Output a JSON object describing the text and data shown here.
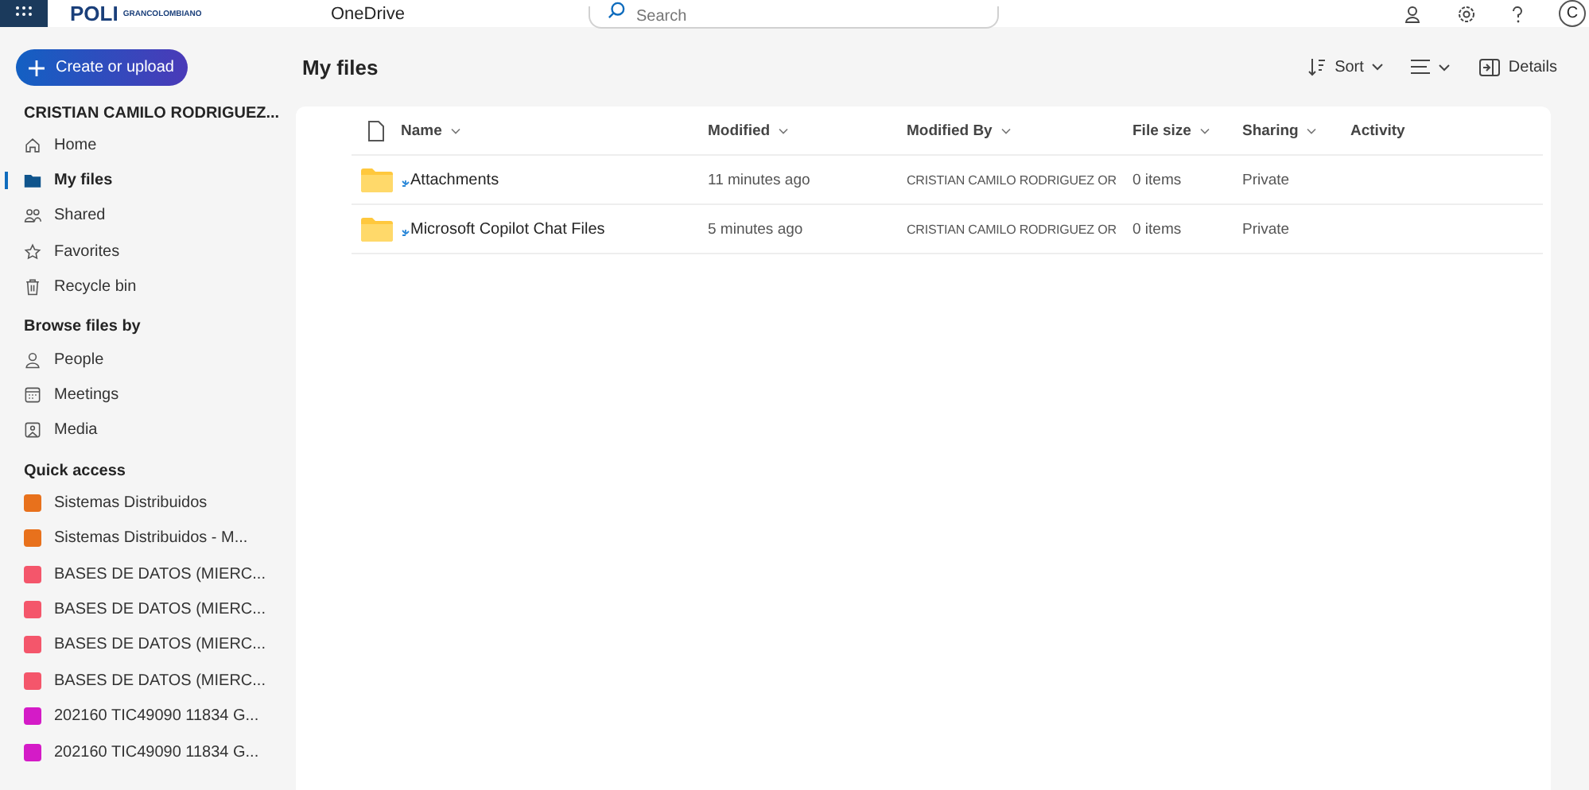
{
  "top_bar": {
    "logo_text": "POLI",
    "logo_subtext": "GRANCOLOMBIANO",
    "app_name": "OneDrive",
    "search": {
      "placeholder": "Search"
    },
    "avatar": "C"
  },
  "create_button": "Create or upload",
  "page_title": "My files",
  "toolbar": {
    "sort": "Sort",
    "details": "Details"
  },
  "sidebar": {
    "account": "CRISTIAN CAMILO RODRIGUEZ...",
    "nav": [
      {
        "label": "Home",
        "selected": false
      },
      {
        "label": "My files",
        "selected": true
      },
      {
        "label": "Shared",
        "selected": false
      },
      {
        "label": "Favorites",
        "selected": false
      },
      {
        "label": "Recycle bin",
        "selected": false
      }
    ],
    "browse_heading": "Browse files by",
    "browse": [
      {
        "label": "People"
      },
      {
        "label": "Meetings"
      },
      {
        "label": "Media"
      }
    ],
    "quick_heading": "Quick access",
    "quick": [
      {
        "label": "Sistemas Distribuidos",
        "color": "#e8711c"
      },
      {
        "label": "Sistemas Distribuidos - M...",
        "color": "#e8711c"
      },
      {
        "label": "BASES DE DATOS (MIERC...",
        "color": "#f4566b"
      },
      {
        "label": "BASES DE DATOS (MIERC...",
        "color": "#f4566b"
      },
      {
        "label": "BASES DE DATOS (MIERC...",
        "color": "#f4566b"
      },
      {
        "label": "BASES DE DATOS (MIERC...",
        "color": "#f4566b"
      },
      {
        "label": "202160 TIC49090 11834 G...",
        "color": "#d41bc7"
      },
      {
        "label": "202160 TIC49090 11834 G...",
        "color": "#d41bc7"
      }
    ]
  },
  "table": {
    "columns": [
      {
        "label": "Name",
        "sortable": true
      },
      {
        "label": "Modified",
        "sortable": true
      },
      {
        "label": "Modified By",
        "sortable": true
      },
      {
        "label": "File size",
        "sortable": true
      },
      {
        "label": "Sharing",
        "sortable": true
      },
      {
        "label": "Activity",
        "sortable": false
      }
    ],
    "rows": [
      {
        "name": "Attachments",
        "modified": "11 minutes ago",
        "modified_by": "CRISTIAN CAMILO RODRIGUEZ OR",
        "file_size": "0 items",
        "sharing": "Private"
      },
      {
        "name": "Microsoft Copilot Chat Files",
        "modified": "5 minutes ago",
        "modified_by": "CRISTIAN CAMILO RODRIGUEZ OR",
        "file_size": "0 items",
        "sharing": "Private"
      }
    ]
  }
}
